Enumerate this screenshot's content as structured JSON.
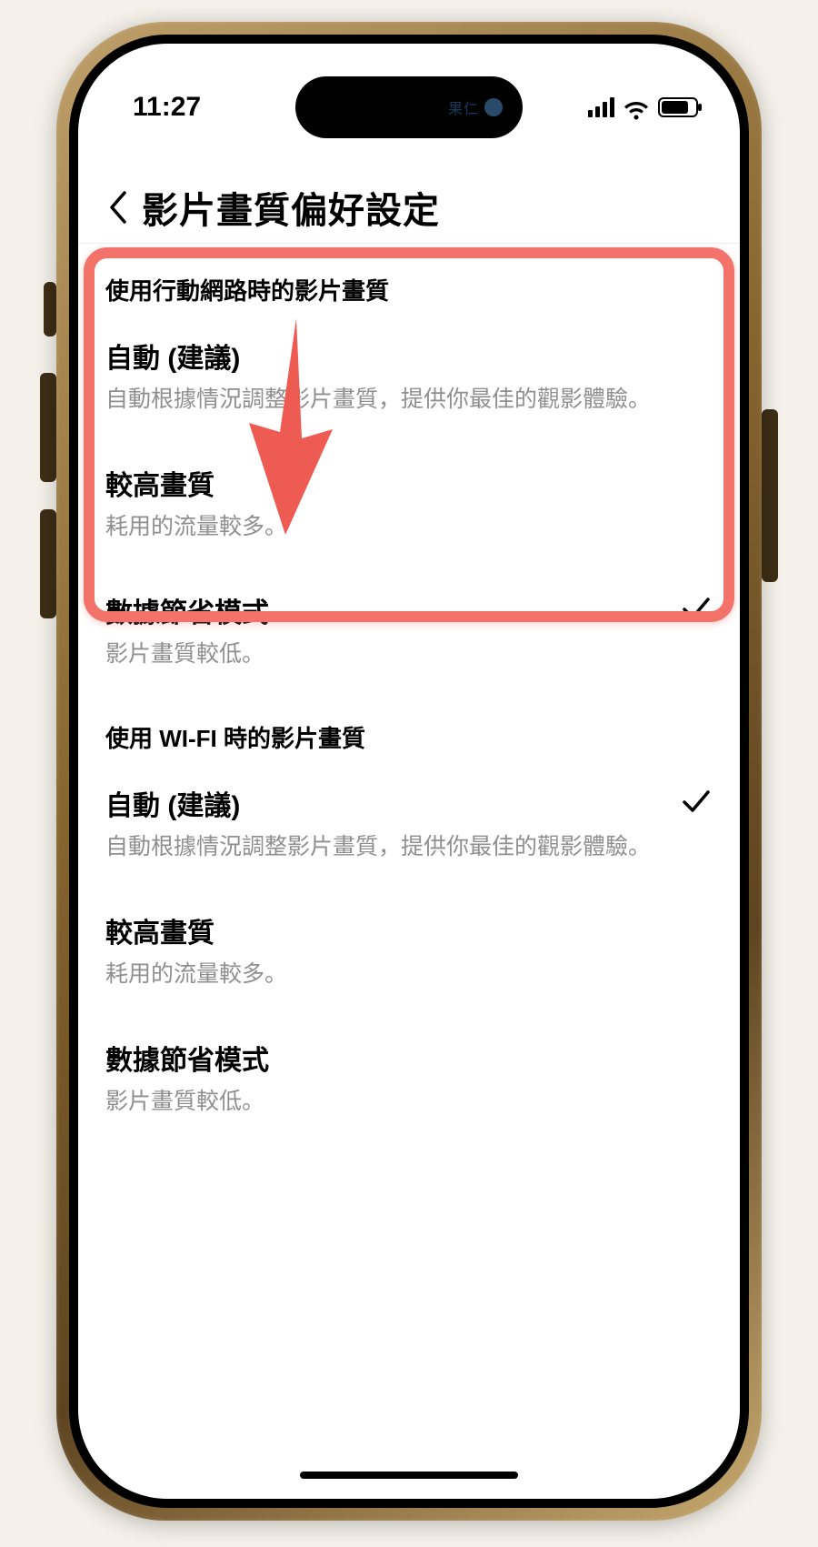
{
  "statusbar": {
    "time": "11:27"
  },
  "island": {
    "label": "果仁"
  },
  "navbar": {
    "title": "影片畫質偏好設定"
  },
  "sections": [
    {
      "header": "使用行動網路時的影片畫質",
      "options": [
        {
          "title": "自動 (建議)",
          "desc": "自動根據情況調整影片畫質，提供你最佳的觀影體驗。",
          "selected": false
        },
        {
          "title": "較高畫質",
          "desc": "耗用的流量較多。",
          "selected": false
        },
        {
          "title": "數據節省模式",
          "desc": "影片畫質較低。",
          "selected": true
        }
      ]
    },
    {
      "header": "使用 WI-FI 時的影片畫質",
      "options": [
        {
          "title": "自動 (建議)",
          "desc": "自動根據情況調整影片畫質，提供你最佳的觀影體驗。",
          "selected": true
        },
        {
          "title": "較高畫質",
          "desc": "耗用的流量較多。",
          "selected": false
        },
        {
          "title": "數據節省模式",
          "desc": "影片畫質較低。",
          "selected": false
        }
      ]
    }
  ],
  "annotation": {
    "highlight_section_index": 0
  },
  "colors": {
    "highlight": "#f3736a",
    "arrow": "#ee5b52"
  }
}
